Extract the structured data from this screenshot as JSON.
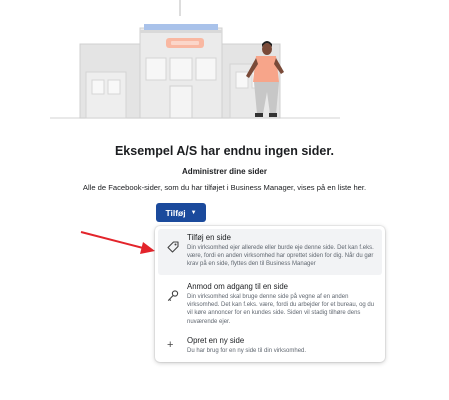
{
  "illustration": {
    "icon": "storefront-person-illustration"
  },
  "empty_state": {
    "title": "Eksempel A/S har endnu ingen sider.",
    "section_heading": "Administrer dine sider",
    "description": "Alle de Facebook-sider, som du har tilføjet i Business Manager, vises på en liste her."
  },
  "add_button": {
    "label": "Tilføj",
    "icon": "caret-down-icon",
    "color": "#1b4a9c"
  },
  "annotation": {
    "icon": "red-arrow",
    "color": "#e3242b"
  },
  "dropdown": {
    "items": [
      {
        "title": "Tilføj en side",
        "description": "Din virksomhed ejer allerede eller burde eje denne side. Det kan f.eks. være, fordi en anden virksomhed har oprettet siden for dig. Når du gør krav på en side, flyttes den til Business Manager",
        "icon": "tag-icon",
        "highlighted": true
      },
      {
        "title": "Anmod om adgang til en side",
        "description": "Din virksomhed skal bruge denne side på vegne af en anden virksomhed. Det kan f.eks. være, fordi du arbejder for et bureau, og du vil køre annoncer for en kundes side. Siden vil stadig tilhøre dens nuværende ejer.",
        "icon": "key-icon",
        "highlighted": false
      },
      {
        "title": "Opret en ny side",
        "description": "Du har brug for en ny side til din virksomhed.",
        "icon": "plus-icon",
        "highlighted": false
      }
    ]
  }
}
